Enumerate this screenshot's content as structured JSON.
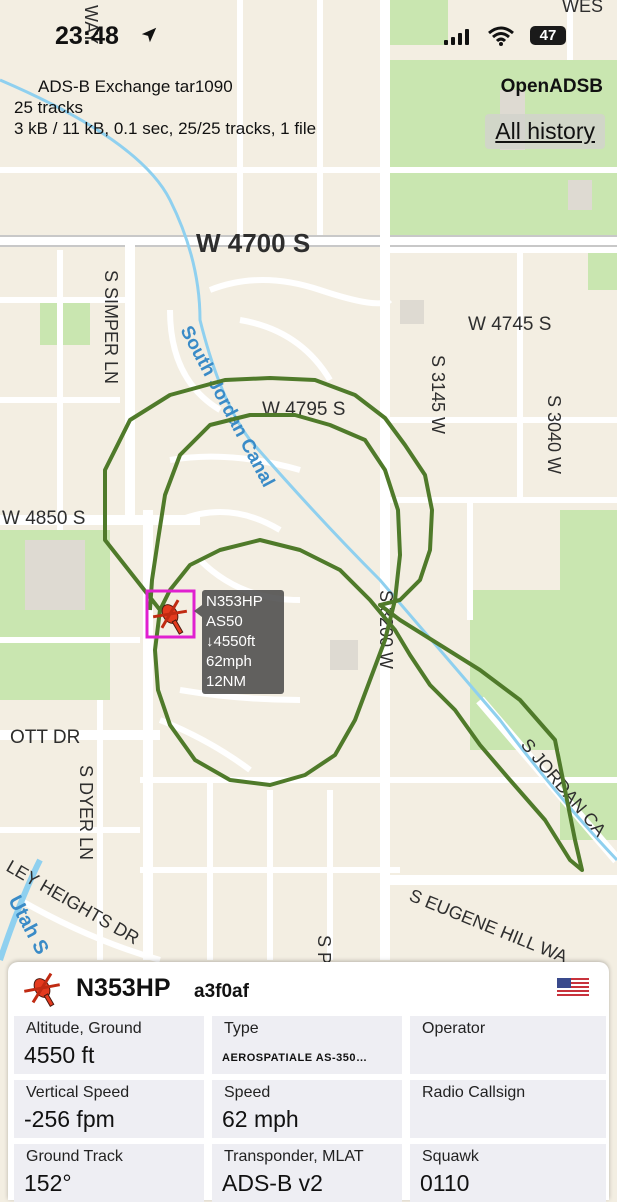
{
  "status_bar": {
    "time": "23:48",
    "battery": "47",
    "icons": [
      "location-arrow-icon",
      "signal-icon",
      "wifi-icon",
      "battery-icon"
    ]
  },
  "header": {
    "source": "ADS-B Exchange tar1090",
    "tracks": "25 tracks",
    "stats": "3 kB / 11 kB, 0.1 sec, 25/25 tracks, 1 file",
    "brand": "OpenADSB",
    "history_button": "All history"
  },
  "map": {
    "streets": {
      "w4700": "W 4700 S",
      "w4745": "W 4745 S",
      "w4795": "W 4795 S",
      "w4850": "W 4850 S",
      "simper": "S SIMPER LN",
      "s3145": "S 3145 W",
      "s3040": "S 3040 W",
      "s3200": "S 3200 W",
      "ott": "OTT DR",
      "dyer": "S DYER LN",
      "valley": "LEY HEIGHTS DR",
      "eugene": "S EUGENE HILL WA",
      "sjordan": "S JORDAN CA",
      "wtop": "WES",
      "wayTop": "WAY",
      "sp": "S P"
    },
    "water": {
      "canal": "South Jordan Canal",
      "utah": "Utah S"
    },
    "track_color": "#4f7a2a",
    "selected_box_color": "#e020d0"
  },
  "aircraft_label": {
    "registration": "N353HP",
    "type": "AS50",
    "altitude": "↓4550ft",
    "speed": "62mph",
    "distance": "12NM"
  },
  "panel": {
    "icon": "helicopter-icon",
    "registration": "N353HP",
    "hex": "a3f0af",
    "flag": "us-flag-icon",
    "cells": [
      {
        "label": "Altitude, Ground",
        "value": "4550 ft"
      },
      {
        "label": "Type",
        "value": "AEROSPATIALE AS-350…"
      },
      {
        "label": "Operator",
        "value": ""
      },
      {
        "label": "Vertical Speed",
        "value": "-256 fpm"
      },
      {
        "label": "Speed",
        "value": "62 mph"
      },
      {
        "label": "Radio Callsign",
        "value": ""
      },
      {
        "label": "Ground Track",
        "value": "152°"
      },
      {
        "label": "Transponder, MLAT",
        "value": "ADS-B v2"
      },
      {
        "label": "Squawk",
        "value": "0110"
      }
    ]
  }
}
